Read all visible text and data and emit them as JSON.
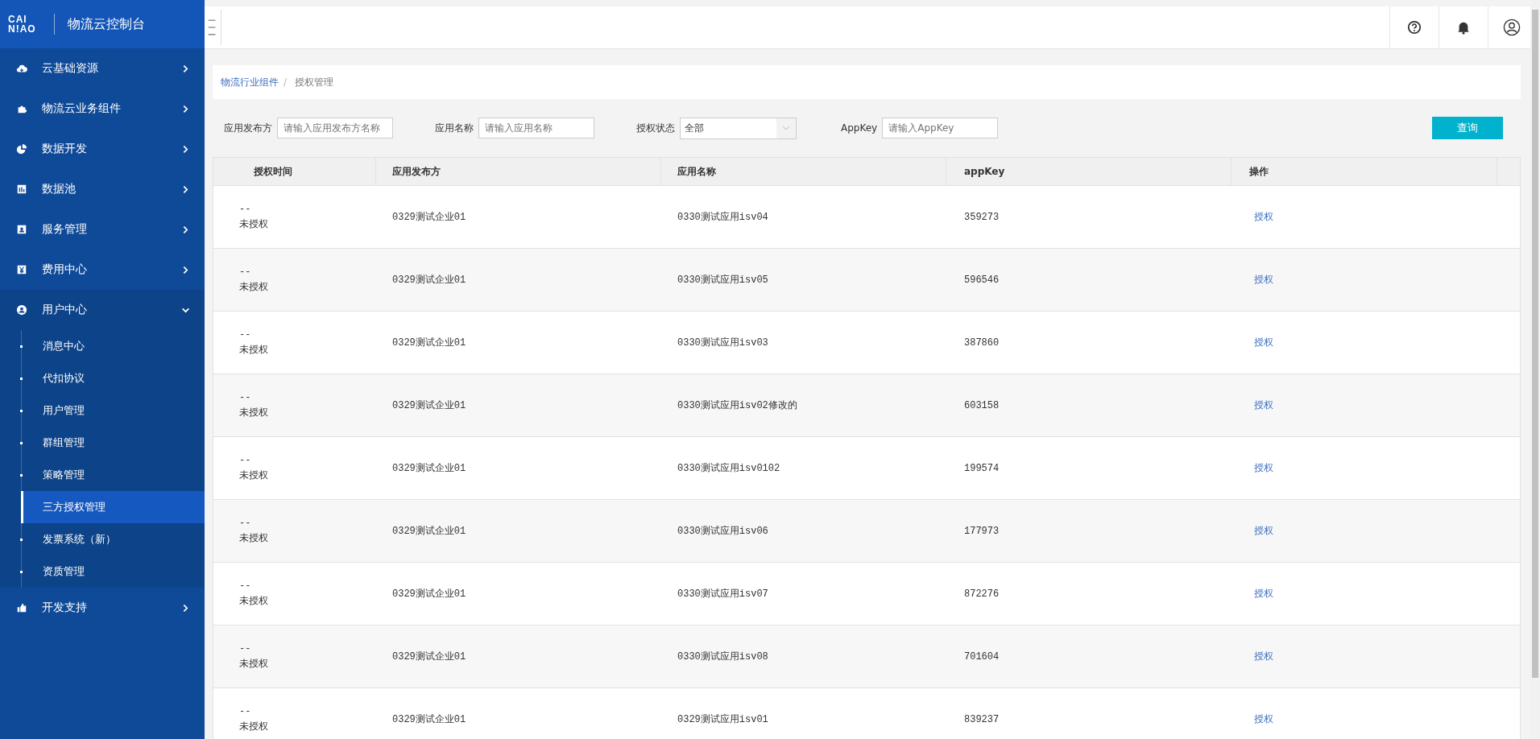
{
  "logo": {
    "mark_lines": [
      "CAI",
      "N!AO"
    ],
    "title": "物流云控制台"
  },
  "sidebar": {
    "items": [
      {
        "label": "云基础资源",
        "expanded": false
      },
      {
        "label": "物流云业务组件",
        "expanded": false
      },
      {
        "label": "数据开发",
        "expanded": false
      },
      {
        "label": "数据池",
        "expanded": false
      },
      {
        "label": "服务管理",
        "expanded": false
      },
      {
        "label": "费用中心",
        "expanded": false
      },
      {
        "label": "用户中心",
        "expanded": true,
        "children": [
          {
            "label": "消息中心",
            "selected": false
          },
          {
            "label": "代扣协议",
            "selected": false
          },
          {
            "label": "用户管理",
            "selected": false
          },
          {
            "label": "群组管理",
            "selected": false
          },
          {
            "label": "策略管理",
            "selected": false
          },
          {
            "label": "三方授权管理",
            "selected": true
          },
          {
            "label": "发票系统（新）",
            "selected": false
          },
          {
            "label": "资质管理",
            "selected": false
          }
        ]
      },
      {
        "label": "开发支持",
        "expanded": false
      }
    ]
  },
  "breadcrumb": [
    {
      "label": "物流行业组件",
      "kind": "link"
    },
    {
      "label": "授权管理",
      "kind": "current"
    }
  ],
  "breadcrumb_separator": "/",
  "filters": [
    {
      "kind": "input",
      "label": "应用发布方",
      "placeholder": "请输入应用发布方名称"
    },
    {
      "kind": "input",
      "label": "应用名称",
      "placeholder": "请输入应用名称"
    },
    {
      "kind": "select",
      "label": "授权状态",
      "value": "全部"
    },
    {
      "kind": "input",
      "label": "AppKey",
      "placeholder": "请输入AppKey"
    }
  ],
  "search_button": "查询",
  "table": {
    "columns": [
      "授权时间",
      "应用发布方",
      "应用名称",
      "appKey",
      "操作"
    ],
    "rows": [
      {
        "time": "--",
        "status": "未授权",
        "publisher": "0329测试企业01",
        "app_name": "0330测试应用isv04",
        "app_key": "359273",
        "action": "授权"
      },
      {
        "time": "--",
        "status": "未授权",
        "publisher": "0329测试企业01",
        "app_name": "0330测试应用isv05",
        "app_key": "596546",
        "action": "授权"
      },
      {
        "time": "--",
        "status": "未授权",
        "publisher": "0329测试企业01",
        "app_name": "0330测试应用isv03",
        "app_key": "387860",
        "action": "授权"
      },
      {
        "time": "--",
        "status": "未授权",
        "publisher": "0329测试企业01",
        "app_name": "0330测试应用isv02修改的",
        "app_key": "603158",
        "action": "授权"
      },
      {
        "time": "--",
        "status": "未授权",
        "publisher": "0329测试企业01",
        "app_name": "0330测试应用isv0102",
        "app_key": "199574",
        "action": "授权"
      },
      {
        "time": "--",
        "status": "未授权",
        "publisher": "0329测试企业01",
        "app_name": "0330测试应用isv06",
        "app_key": "177973",
        "action": "授权"
      },
      {
        "time": "--",
        "status": "未授权",
        "publisher": "0329测试企业01",
        "app_name": "0330测试应用isv07",
        "app_key": "872276",
        "action": "授权"
      },
      {
        "time": "--",
        "status": "未授权",
        "publisher": "0329测试企业01",
        "app_name": "0330测试应用isv08",
        "app_key": "701604",
        "action": "授权"
      },
      {
        "time": "--",
        "status": "未授权",
        "publisher": "0329测试企业01",
        "app_name": "0329测试应用isv01",
        "app_key": "839237",
        "action": "授权"
      }
    ]
  }
}
